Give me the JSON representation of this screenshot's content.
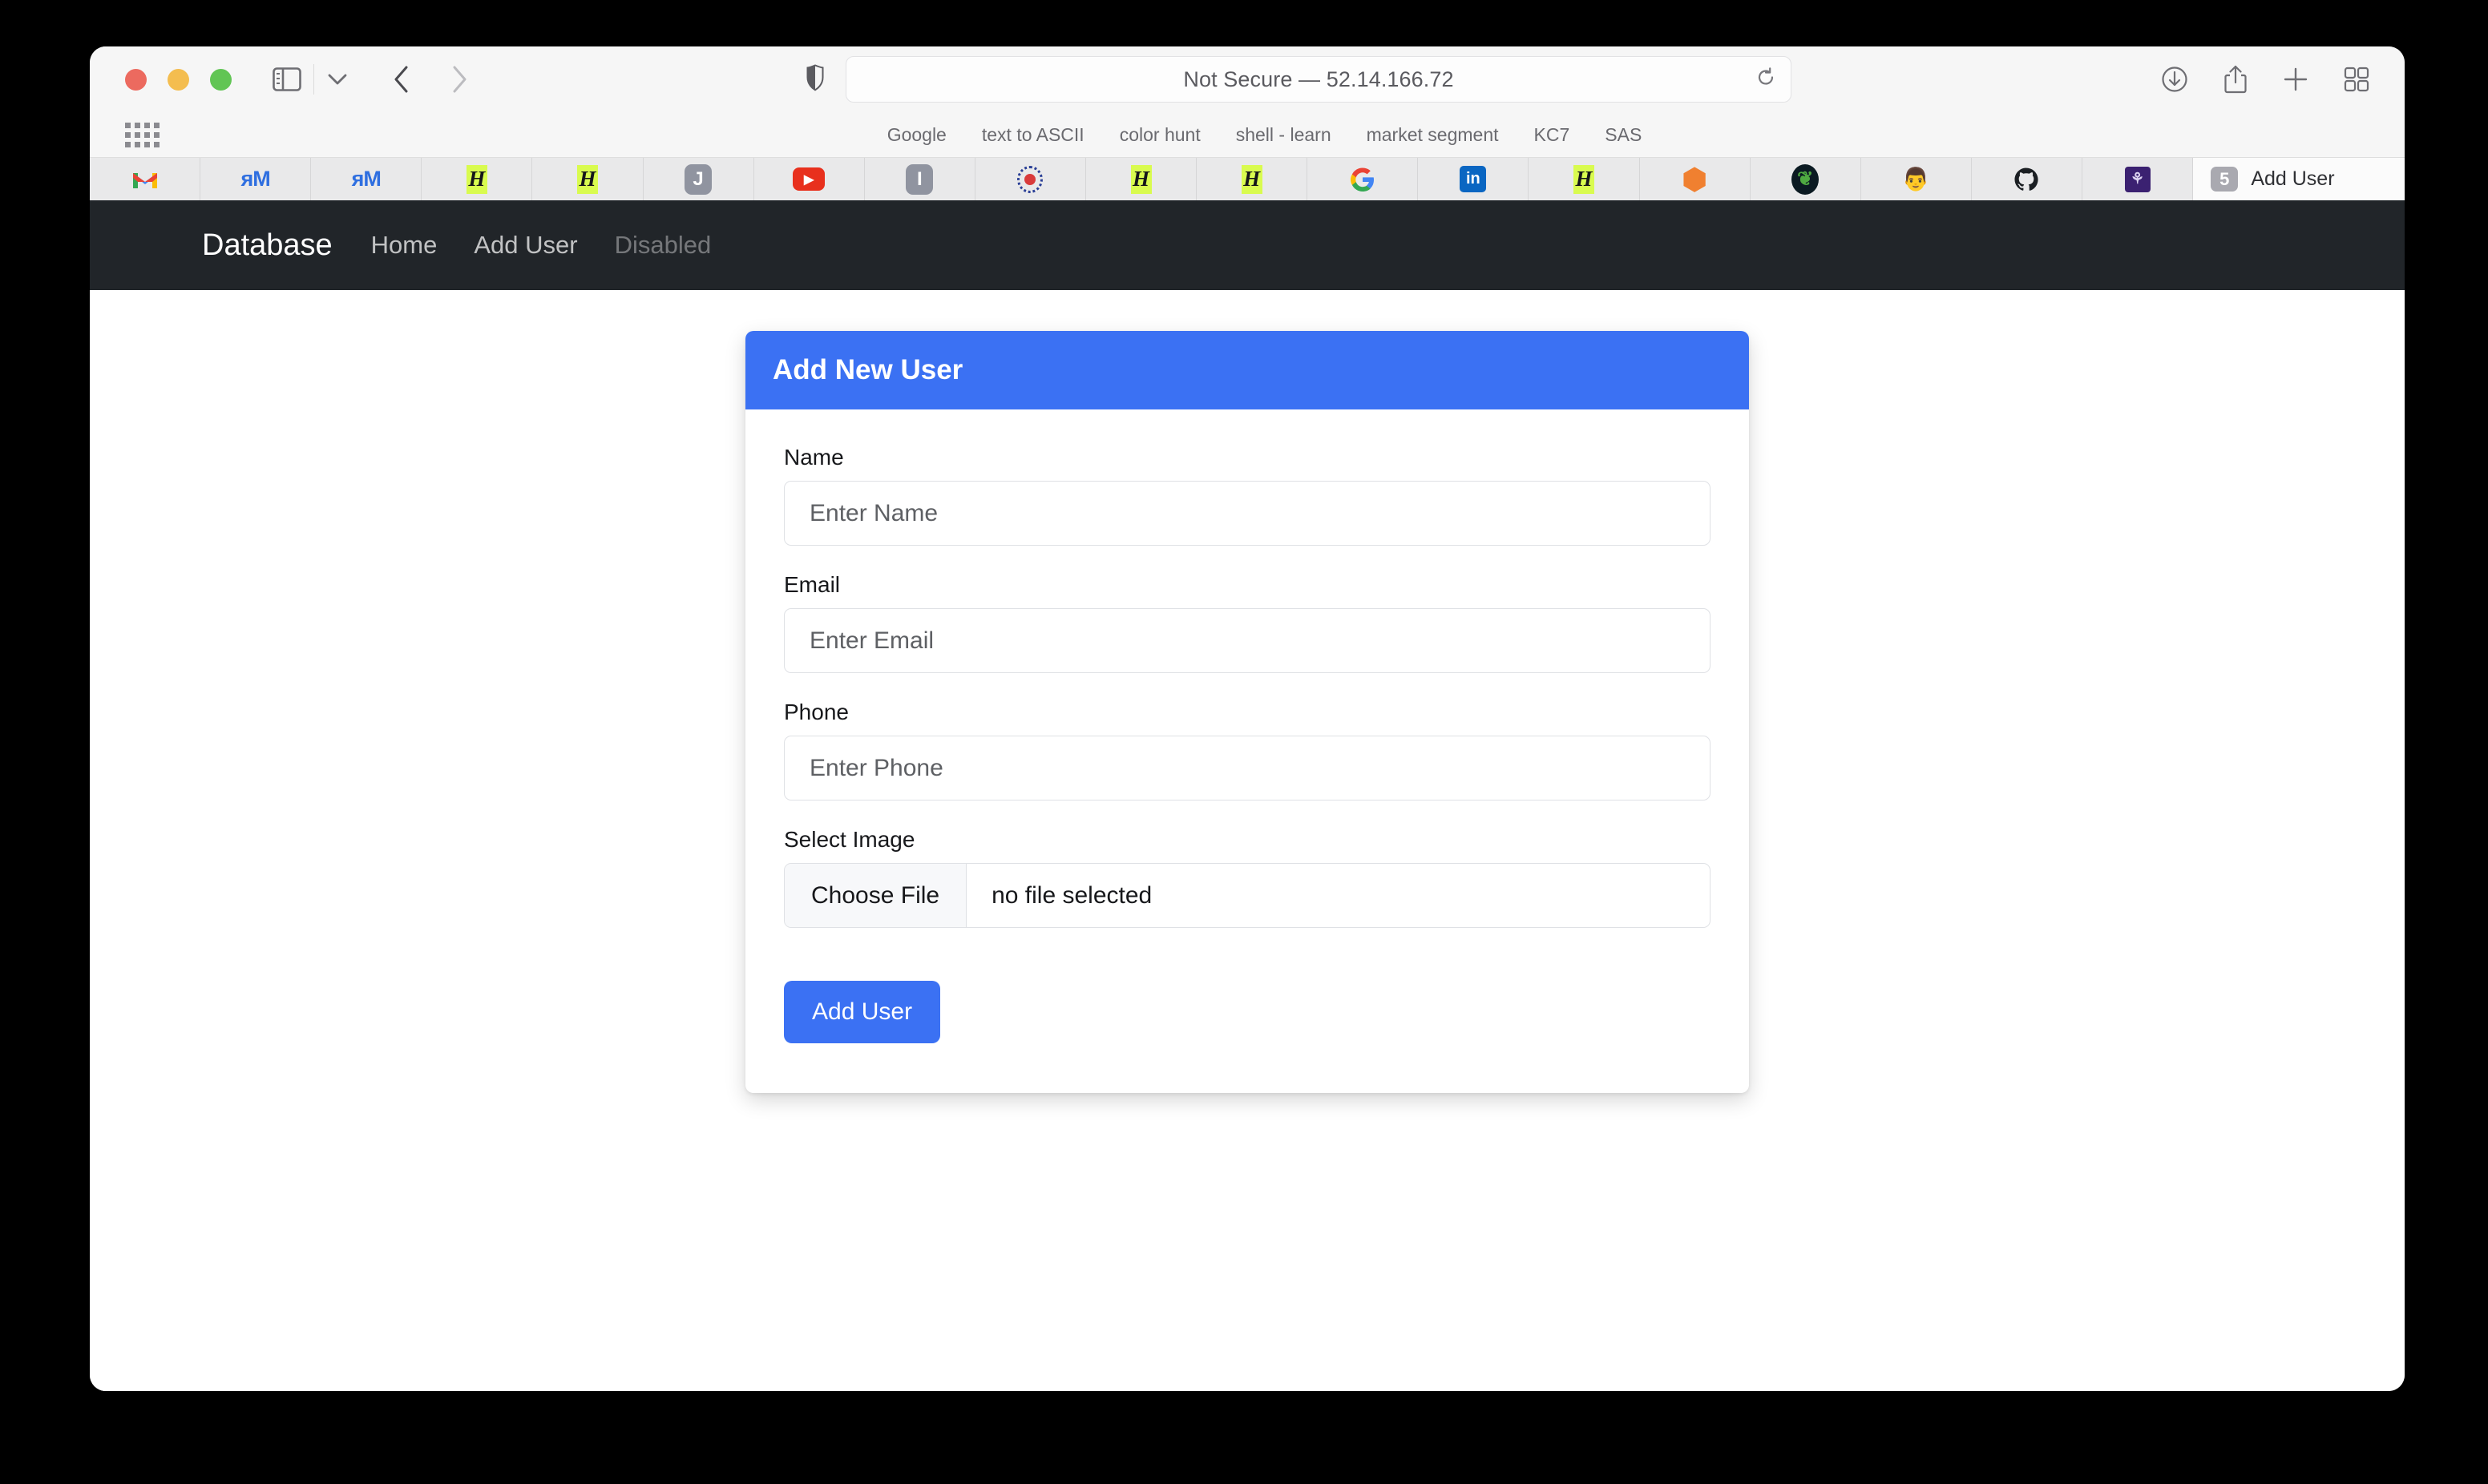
{
  "browser": {
    "url_text": "Not Secure — 52.14.166.72",
    "traffic_lights": [
      "close",
      "minimize",
      "zoom"
    ],
    "toolbar_icons": [
      "sidebar-icon",
      "chevron-down-icon",
      "back-icon",
      "forward-icon",
      "shield-icon",
      "reload-icon",
      "downloads-icon",
      "share-icon",
      "new-tab-icon",
      "tab-overview-icon"
    ],
    "bookmarks": [
      {
        "label": "Google"
      },
      {
        "label": "text to ASCII"
      },
      {
        "label": "color hunt"
      },
      {
        "label": "shell - learn"
      },
      {
        "label": "market segment"
      },
      {
        "label": "KC7"
      },
      {
        "label": "SAS"
      }
    ],
    "tabs": [
      {
        "icon": "gmail-icon",
        "glyph": "M"
      },
      {
        "icon": "rm-logo-icon",
        "glyph": "RM"
      },
      {
        "icon": "rm-logo-icon",
        "glyph": "RM"
      },
      {
        "icon": "h-highlight-icon",
        "glyph": "H"
      },
      {
        "icon": "h-highlight-icon",
        "glyph": "H"
      },
      {
        "icon": "j-square-icon",
        "glyph": "J"
      },
      {
        "icon": "youtube-icon",
        "glyph": "▶"
      },
      {
        "icon": "i-square-icon",
        "glyph": "I"
      },
      {
        "icon": "seal-crest-icon",
        "glyph": ""
      },
      {
        "icon": "h-highlight-icon",
        "glyph": "H"
      },
      {
        "icon": "h-highlight-icon",
        "glyph": "H"
      },
      {
        "icon": "google-icon",
        "glyph": "G"
      },
      {
        "icon": "linkedin-icon",
        "glyph": "in"
      },
      {
        "icon": "h-highlight-icon",
        "glyph": "H"
      },
      {
        "icon": "hexagon-package-icon",
        "glyph": "⬢"
      },
      {
        "icon": "mongodb-leaf-icon",
        "glyph": "❦"
      },
      {
        "icon": "avatar-icon",
        "glyph": "👨"
      },
      {
        "icon": "github-icon",
        "glyph": ""
      },
      {
        "icon": "purple-app-icon",
        "glyph": "⚘"
      }
    ],
    "active_tab": {
      "badge": "5",
      "title": "Add User"
    }
  },
  "navbar": {
    "brand": "Database",
    "links": [
      {
        "label": "Home",
        "state": "normal"
      },
      {
        "label": "Add User",
        "state": "normal"
      },
      {
        "label": "Disabled",
        "state": "disabled"
      }
    ]
  },
  "card": {
    "header": "Add New User",
    "fields": [
      {
        "label": "Name",
        "placeholder": "Enter Name",
        "value": ""
      },
      {
        "label": "Email",
        "placeholder": "Enter Email",
        "value": ""
      },
      {
        "label": "Phone",
        "placeholder": "Enter Phone",
        "value": ""
      }
    ],
    "file_field": {
      "label": "Select Image",
      "button": "Choose File",
      "status": "no file selected"
    },
    "submit": "Add User"
  },
  "colors": {
    "primary": "#3b71f3",
    "navbar": "#212529",
    "highlight": "#d9fb4f"
  }
}
